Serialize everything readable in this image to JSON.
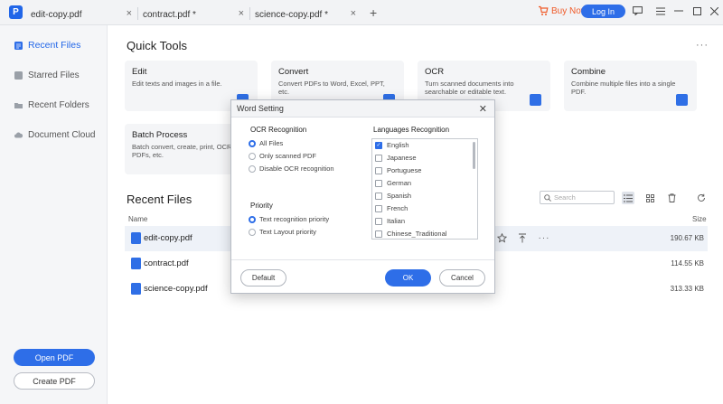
{
  "titlebar": {
    "tabs": [
      {
        "label": "edit-copy.pdf"
      },
      {
        "label": "contract.pdf *"
      },
      {
        "label": "science-copy.pdf *"
      }
    ],
    "buy_now": "Buy Now",
    "log_in": "Log In"
  },
  "sidebar": {
    "items": [
      {
        "label": "Recent Files"
      },
      {
        "label": "Starred Files"
      },
      {
        "label": "Recent Folders"
      },
      {
        "label": "Document Cloud"
      }
    ],
    "open_pdf": "Open PDF",
    "create_pdf": "Create PDF"
  },
  "quick_tools": {
    "title": "Quick Tools",
    "cards": [
      {
        "title": "Edit",
        "desc": "Edit texts and images in a file."
      },
      {
        "title": "Convert",
        "desc": "Convert PDFs to Word, Excel, PPT, etc."
      },
      {
        "title": "OCR",
        "desc": "Turn scanned documents into searchable or editable text."
      },
      {
        "title": "Combine",
        "desc": "Combine multiple files into a single PDF."
      },
      {
        "title": "Batch Process",
        "desc": "Batch convert, create, print, OCR PDFs, etc."
      }
    ]
  },
  "recent_files": {
    "title": "Recent Files",
    "search_placeholder": "Search",
    "col_name": "Name",
    "col_size": "Size",
    "rows": [
      {
        "name": "edit-copy.pdf",
        "size": "190.67 KB"
      },
      {
        "name": "contract.pdf",
        "size": "114.55 KB"
      },
      {
        "name": "science-copy.pdf",
        "size": "313.33 KB"
      }
    ]
  },
  "dialog": {
    "title": "Word Setting",
    "ocr_label": "OCR Recognition",
    "ocr_options": [
      "All Files",
      "Only scanned PDF",
      "Disable OCR recognition"
    ],
    "priority_label": "Priority",
    "priority_options": [
      "Text recognition priority",
      "Text Layout priority"
    ],
    "lang_label": "Languages Recognition",
    "languages": [
      "English",
      "Japanese",
      "Portuguese",
      "German",
      "Spanish",
      "French",
      "Italian",
      "Chinese_Traditional"
    ],
    "default": "Default",
    "ok": "OK",
    "cancel": "Cancel"
  },
  "colors": {
    "accent": "#2e6ee8",
    "buy_now": "#f05a28"
  }
}
